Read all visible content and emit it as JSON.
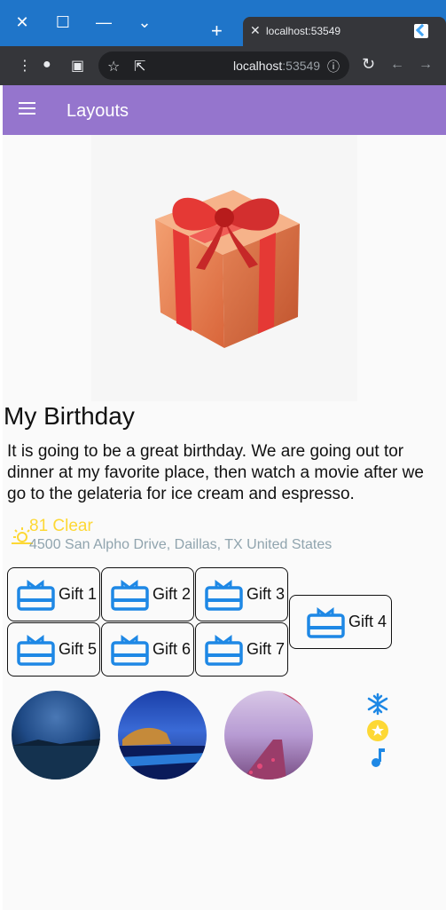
{
  "browser": {
    "tab_title": "localhost:53549",
    "address_host": "localhost",
    "address_port": ":53549"
  },
  "appbar": {
    "title": "Layouts"
  },
  "post": {
    "title": "My Birthday",
    "description": "It is going to be a great birthday. We are going out tor dinner at my favorite place, then watch a movie after we go to the gelateria for ice cream and espresso."
  },
  "weather": {
    "temperature": "81 Clear",
    "address": "4500 San Alpho Drive, Daillas, TX United States"
  },
  "gifts": [
    {
      "label": "Gift 1"
    },
    {
      "label": "Gift 2"
    },
    {
      "label": "Gift 3"
    },
    {
      "label": "Gift 4"
    },
    {
      "label": "Gift 5"
    },
    {
      "label": "Gift 6"
    },
    {
      "label": "Gift 7"
    }
  ],
  "side_icons": [
    "snowflake-icon",
    "star-icon",
    "music-note-icon"
  ],
  "colors": {
    "appbar": "#9575cd",
    "accent": "#1e88e5",
    "weather": "#fdd835",
    "address": "#90a4ae"
  }
}
